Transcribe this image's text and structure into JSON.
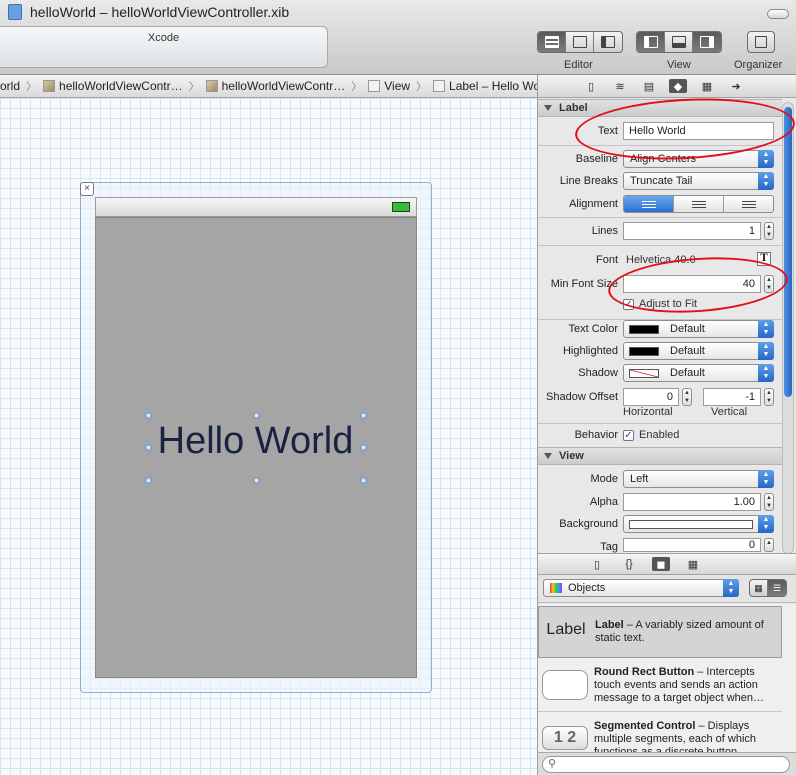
{
  "window": {
    "title": "helloWorld – helloWorldViewController.xib"
  },
  "activity": {
    "label": "Xcode"
  },
  "toolbar": {
    "editor_label": "Editor",
    "view_label": "View",
    "organizer_label": "Organizer"
  },
  "jumpbar": {
    "items": [
      "orld",
      "helloWorldViewContr…",
      "helloWorldViewContr…",
      "View",
      "Label – Hello World"
    ]
  },
  "canvas": {
    "label_text": "Hello World",
    "close_glyph": "×"
  },
  "inspector": {
    "label_section": "Label",
    "text_label": "Text",
    "text_value": "Hello World",
    "baseline_label": "Baseline",
    "baseline_value": "Align Centers",
    "line_breaks_label": "Line Breaks",
    "line_breaks_value": "Truncate Tail",
    "alignment_label": "Alignment",
    "lines_label": "Lines",
    "lines_value": "1",
    "font_label": "Font",
    "font_value": "Helvetica 40.0",
    "font_button": "T",
    "min_font_label": "Min Font Size",
    "min_font_value": "40",
    "adjust_label": "Adjust to Fit",
    "text_color_label": "Text Color",
    "text_color_value": "Default",
    "highlighted_label": "Highlighted",
    "highlighted_value": "Default",
    "shadow_label": "Shadow",
    "shadow_value": "Default",
    "shadow_offset_label": "Shadow Offset",
    "shadow_h_value": "0",
    "shadow_v_value": "-1",
    "horizontal_label": "Horizontal",
    "vertical_label": "Vertical",
    "behavior_label": "Behavior",
    "enabled_label": "Enabled",
    "view_section": "View",
    "mode_label": "Mode",
    "mode_value": "Left",
    "alpha_label": "Alpha",
    "alpha_value": "1.00",
    "background_label": "Background",
    "tag_label": "Tag",
    "tag_value": "0"
  },
  "library": {
    "filter_value": "Objects",
    "items": [
      {
        "thumb": "Label",
        "name": "Label",
        "desc": " – A variably sized amount of static text."
      },
      {
        "thumb": "",
        "name": "Round Rect Button",
        "desc": " – Intercepts touch events and sends an action message to a target object when…"
      },
      {
        "thumb": "1 2",
        "name": "Segmented Control",
        "desc": " – Displays multiple segments, each of which functions as a discrete button."
      }
    ]
  }
}
